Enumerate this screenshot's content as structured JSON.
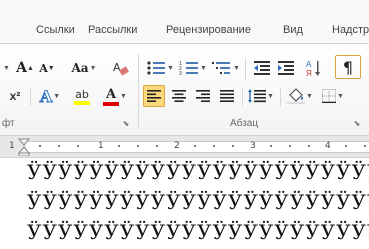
{
  "tabs": [
    "Ссылки",
    "Рассылки",
    "Рецензирование",
    "Вид",
    "Надстр"
  ],
  "ribbon": {
    "group_font_label_partial": "фт",
    "group_paragraph_label": "Абзац",
    "buttons": {
      "grow_font": "A",
      "shrink_font": "A",
      "change_case": "Aa",
      "clear_format": "A",
      "superscript": "x²",
      "text_effects": "A",
      "font_color": "A",
      "highlight": "ab",
      "show_marks": "¶"
    },
    "colors": {
      "highlight_bar": "#ffff00",
      "font_color_bar": "#e00000",
      "active_button": "#fbd87a",
      "show_marks_button": "#f6c66c"
    }
  },
  "ruler": {
    "numbers": [
      "1",
      "1",
      "2",
      "3",
      "4"
    ]
  },
  "document": {
    "lines": [
      "ӰӰӰӰӰӰӰӰӰӰӰӰӰӰӰӰӰӰӰӰӰӰӰ",
      "ӰӰӰӰӰӰӰӰӰӰӰӰӰӰӰӰӰӰӰӰӰӰӰ",
      "ӰӰӰӰӰӰӰӰӰӰӰӰӰӰӰӰӰӰӰӰӰӰӰ"
    ]
  }
}
